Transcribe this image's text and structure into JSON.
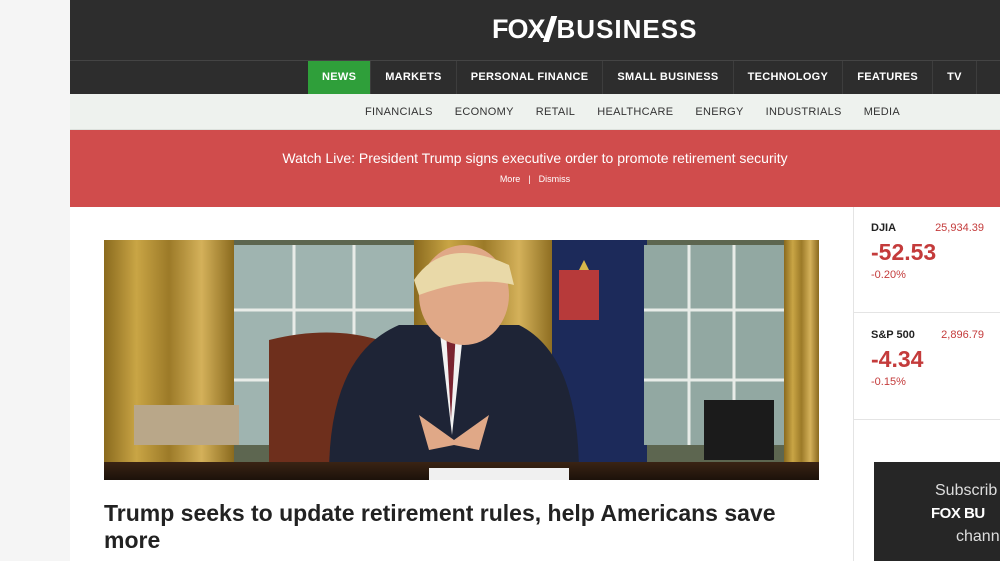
{
  "header": {
    "logo_fox": "FOX",
    "logo_business": "BUSINESS"
  },
  "main_nav": [
    {
      "label": "NEWS",
      "active": true
    },
    {
      "label": "MARKETS",
      "active": false
    },
    {
      "label": "PERSONAL FINANCE",
      "active": false
    },
    {
      "label": "SMALL BUSINESS",
      "active": false
    },
    {
      "label": "TECHNOLOGY",
      "active": false
    },
    {
      "label": "FEATURES",
      "active": false
    },
    {
      "label": "TV",
      "active": false
    }
  ],
  "sub_nav": [
    "FINANCIALS",
    "ECONOMY",
    "RETAIL",
    "HEALTHCARE",
    "ENERGY",
    "INDUSTRIALS",
    "MEDIA"
  ],
  "alert": {
    "title": "Watch Live: President Trump signs executive order to promote retirement security",
    "more": "More",
    "separator": "|",
    "dismiss": "Dismiss"
  },
  "article": {
    "headline": "Trump seeks to update retirement rules, help Americans save more"
  },
  "tickers": [
    {
      "name": "DJIA",
      "price": "25,934.39",
      "change": "-52.53",
      "pct": "-0.20%"
    },
    {
      "name": "S&P 500",
      "price": "2,896.79",
      "change": "-4.34",
      "pct": "-0.15%"
    }
  ],
  "promo": {
    "line1": "Subscrib",
    "logo": "FOX BU",
    "line3": "chann"
  },
  "colors": {
    "header_bg": "#2d2d2d",
    "active_nav": "#2f9f3a",
    "alert_bg": "#d04c4c",
    "negative": "#c43b3b"
  }
}
